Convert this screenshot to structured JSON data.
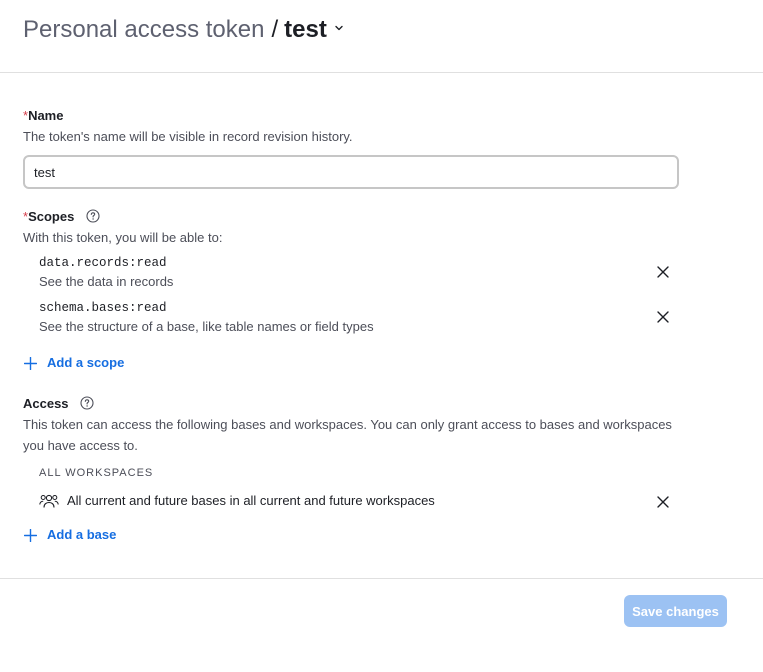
{
  "header": {
    "crumb": "Personal access token",
    "separator": "/",
    "current": "test",
    "menu_icon": "chevron-down-icon"
  },
  "name_field": {
    "required_marker": "*",
    "label": "Name",
    "help": "The token's name will be visible in record revision history.",
    "value": "test"
  },
  "scopes": {
    "required_marker": "*",
    "label": "Scopes",
    "help_icon": "question-circle-icon",
    "help": "With this token, you will be able to:",
    "items": [
      {
        "code": "data.records:read",
        "description": "See the data in records",
        "remove_icon": "close-icon"
      },
      {
        "code": "schema.bases:read",
        "description": "See the structure of a base, like table names or field types",
        "remove_icon": "close-icon"
      }
    ],
    "add_label": "Add a scope",
    "add_icon": "plus-icon"
  },
  "access": {
    "label": "Access",
    "help_icon": "question-circle-icon",
    "help": "This token can access the following bases and workspaces. You can only grant access to bases and workspaces you have access to.",
    "workspaces_heading": "ALL WORKSPACES",
    "workspace_item": {
      "icon": "users-icon",
      "text": "All current and future bases in all current and future workspaces",
      "remove_icon": "close-icon"
    },
    "add_label": "Add a base",
    "add_icon": "plus-icon"
  },
  "footer": {
    "save_label": "Save changes"
  },
  "colors": {
    "accent": "#166ee1",
    "required": "#d43c4a",
    "save_button_disabled": "#9cc2f3",
    "divider": "#e0e0e0"
  }
}
